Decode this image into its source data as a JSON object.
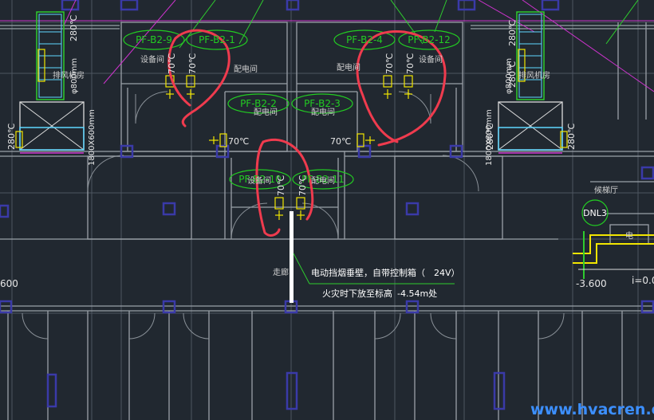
{
  "drawing": {
    "background": "#212830",
    "colors": {
      "wall": "#dcdcdc",
      "grid": "#9aa1a8",
      "grid_dim": "#4d5660",
      "column": "#3a3aa8",
      "tag_ellipse": "#22cc22",
      "tag_text": "#22cc22",
      "annotation_red": "#ef3b4e",
      "magenta": "#cc33cc",
      "green": "#2ecc2e",
      "yellow": "#f2e600",
      "cyan": "#5fd7ff",
      "text": "#e6e6e6",
      "watermark": "#3c8fff"
    }
  },
  "tags": [
    {
      "id": "t1",
      "label": "PF-B2-9"
    },
    {
      "id": "t2",
      "label": "PF-B2-1"
    },
    {
      "id": "t3",
      "label": "PF-B2-4"
    },
    {
      "id": "t4",
      "label": "PF-B2-12"
    },
    {
      "id": "t5",
      "label": "PF-B2-2"
    },
    {
      "id": "t6",
      "label": "PF-B2-3"
    },
    {
      "id": "t7",
      "label": "PF-B2-10"
    },
    {
      "id": "t8",
      "label": "PF-B2-11"
    },
    {
      "id": "t9",
      "label": "DNL3"
    }
  ],
  "room_labels": [
    {
      "id": "r1",
      "text": "设备间"
    },
    {
      "id": "r2",
      "text": "配电间"
    },
    {
      "id": "r3",
      "text": "配电间"
    },
    {
      "id": "r4",
      "text": "设备间"
    },
    {
      "id": "r5",
      "text": "配电间"
    },
    {
      "id": "r6",
      "text": "配电间"
    },
    {
      "id": "r7",
      "text": "设备间"
    },
    {
      "id": "r8",
      "text": "配电间"
    },
    {
      "id": "r9",
      "text": "候梯厅"
    },
    {
      "id": "r10",
      "text": "走廊"
    },
    {
      "id": "r11",
      "text": "排风机房"
    },
    {
      "id": "r12",
      "text": "排风机房"
    },
    {
      "id": "r13",
      "text": "电"
    }
  ],
  "damper_temps": [
    {
      "id": "d1",
      "text": "70℃"
    },
    {
      "id": "d2",
      "text": "70℃"
    },
    {
      "id": "d3",
      "text": "70℃"
    },
    {
      "id": "d4",
      "text": "70℃"
    },
    {
      "id": "d5",
      "text": "70℃"
    },
    {
      "id": "d6",
      "text": "70℃"
    },
    {
      "id": "d7",
      "text": "70℃"
    },
    {
      "id": "d8",
      "text": "70℃"
    },
    {
      "id": "d9",
      "text": "280℃"
    },
    {
      "id": "d10",
      "text": "280℃"
    },
    {
      "id": "d11",
      "text": "280℃"
    },
    {
      "id": "d12",
      "text": "280℃"
    },
    {
      "id": "d13",
      "text": "280℃"
    },
    {
      "id": "d14",
      "text": "280℃"
    }
  ],
  "duct_dims": [
    {
      "id": "u1",
      "text": "1800X600mm"
    },
    {
      "id": "u2",
      "text": "1800X600mm"
    },
    {
      "id": "u3",
      "text": "φ800mm"
    },
    {
      "id": "u4",
      "text": "φ800mm"
    }
  ],
  "note": {
    "line1": "电动挡烟垂壁，自带控制箱（",
    "line1_value": "24V）",
    "line2": "火灾时下放至标高",
    "line2_value": "-4.54m处"
  },
  "levels": [
    {
      "id": "l1",
      "text": "-3.600"
    },
    {
      "id": "l2",
      "text": "i=0.0"
    },
    {
      "id": "l3",
      "text": "600"
    }
  ],
  "watermark": "www.hvacren.cn"
}
